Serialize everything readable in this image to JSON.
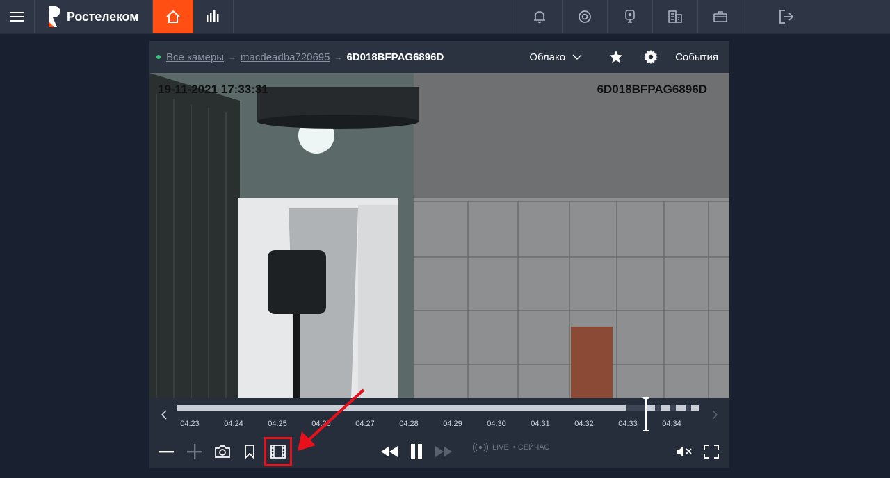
{
  "topbar": {
    "logo_text": "Ростелеком",
    "icons": [
      "menu-icon",
      "home-icon",
      "stats-icon",
      "bell-icon",
      "support-icon",
      "camera-icon",
      "building-icon",
      "briefcase-icon",
      "logout-icon"
    ]
  },
  "breadcrumb": {
    "all_cameras": "Все камеры",
    "group": "macdeadba720695",
    "current": "6D018BFPAG6896D"
  },
  "header_right": {
    "storage": "Облако",
    "events": "События"
  },
  "osd": {
    "datetime": "19-11-2021 17:33:31",
    "camera_id": "6D018BFPAG6896D"
  },
  "timeline": {
    "ticks": [
      "04:23",
      "04:24",
      "04:25",
      "04:26",
      "04:27",
      "04:28",
      "04:29",
      "04:30",
      "04:31",
      "04:32",
      "04:33",
      "04:34"
    ],
    "recorded_fraction": 0.86
  },
  "controls": {
    "live_label": "LIVE",
    "now_label": "• СЕЙЧАС"
  },
  "colors": {
    "accent": "#ff4f12",
    "highlight": "#e8101a",
    "live_dot": "#2ecc71"
  }
}
